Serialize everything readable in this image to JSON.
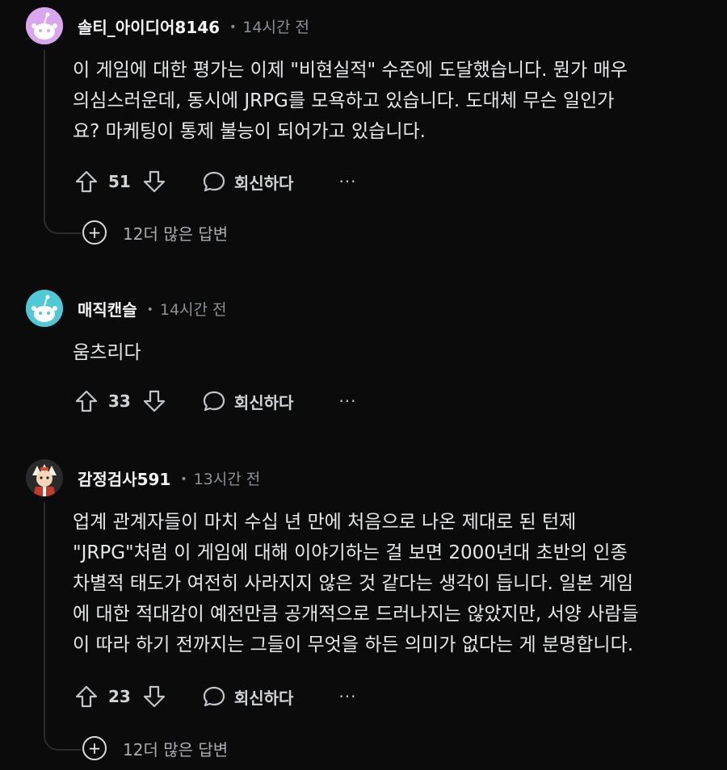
{
  "comments": [
    {
      "author": "솔티_아이디어8146",
      "time": "14시간 전",
      "lines": [
        "이 게임에 대한 평가는 이제 \"비현실적\" 수준에 도달했습니다. 뭔가 매우",
        "의심스러운데, 동시에 JRPG를 모욕하고 있습니다. 도대체 무슨 일인가",
        "요? 마케팅이 통제 불능이 되어가고 있습니다."
      ],
      "votes": "51",
      "reply_label": "회신하다",
      "more": "···",
      "more_replies": "12더 많은 답변",
      "avatar_color": "#d9a7f0"
    },
    {
      "author": "매직캔슬",
      "time": "14시간 전",
      "lines": [
        "움츠리다"
      ],
      "votes": "33",
      "reply_label": "회신하다",
      "more": "···",
      "avatar_color": "#4fc9d6"
    },
    {
      "author": "감정검사591",
      "time": "13시간 전",
      "lines": [
        "업계 관계자들이 마치 수십 년 만에 처음으로 나온 제대로 된 턴제",
        "\"JRPG\"처럼 이 게임에 대해 이야기하는 걸 보면 2000년대 초반의 인종",
        "차별적 태도가 여전히 사라지지 않은 것 같다는 생각이 듭니다. 일본 게임",
        "에 대한 적대감이 예전만큼 공개적으로 드러나지는 않았지만, 서양 사람들",
        "이 따라 하기 전까지는 그들이 무엇을 하든 의미가 없다는 게 분명합니다."
      ],
      "votes": "23",
      "reply_label": "회신하다",
      "more": "···",
      "more_replies": "12더 많은 답변",
      "avatar_color": "#2a2a2a"
    }
  ]
}
